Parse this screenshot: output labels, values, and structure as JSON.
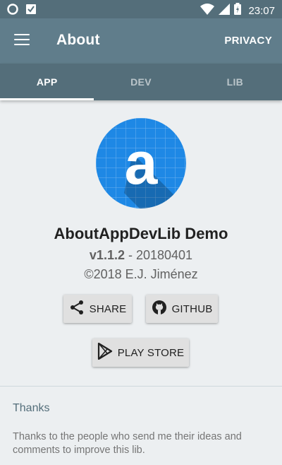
{
  "status_bar": {
    "time": "23:07",
    "icons": [
      "notification-circle-icon",
      "download-check-icon",
      "wifi-icon",
      "signal-icon",
      "battery-charging-icon"
    ]
  },
  "app_bar": {
    "menu_icon": "hamburger-menu-icon",
    "title": "About",
    "action_label": "PRIVACY"
  },
  "tabs": [
    {
      "label": "APP",
      "active": true
    },
    {
      "label": "DEV",
      "active": false
    },
    {
      "label": "LIB",
      "active": false
    }
  ],
  "app": {
    "logo_letter": "a",
    "name": "AboutAppDevLib Demo",
    "version": "v1.1.2",
    "version_separator": " - ",
    "build": "20180401",
    "copyright": "©2018 E.J. Jiménez"
  },
  "buttons": {
    "share": {
      "label": "SHARE",
      "icon": "share-icon"
    },
    "github": {
      "label": "GITHUB",
      "icon": "github-icon"
    },
    "play_store": {
      "label": "PLAY STORE",
      "icon": "play-store-icon"
    }
  },
  "thanks": {
    "title": "Thanks",
    "text": "Thanks to the people who send me their ideas and comments to improve this lib."
  },
  "colors": {
    "status_bar": "#546e7a",
    "app_bar": "#607d8b",
    "tab_bar": "#546e7a",
    "background": "#eceff1",
    "logo_blue": "#1e88e5"
  }
}
